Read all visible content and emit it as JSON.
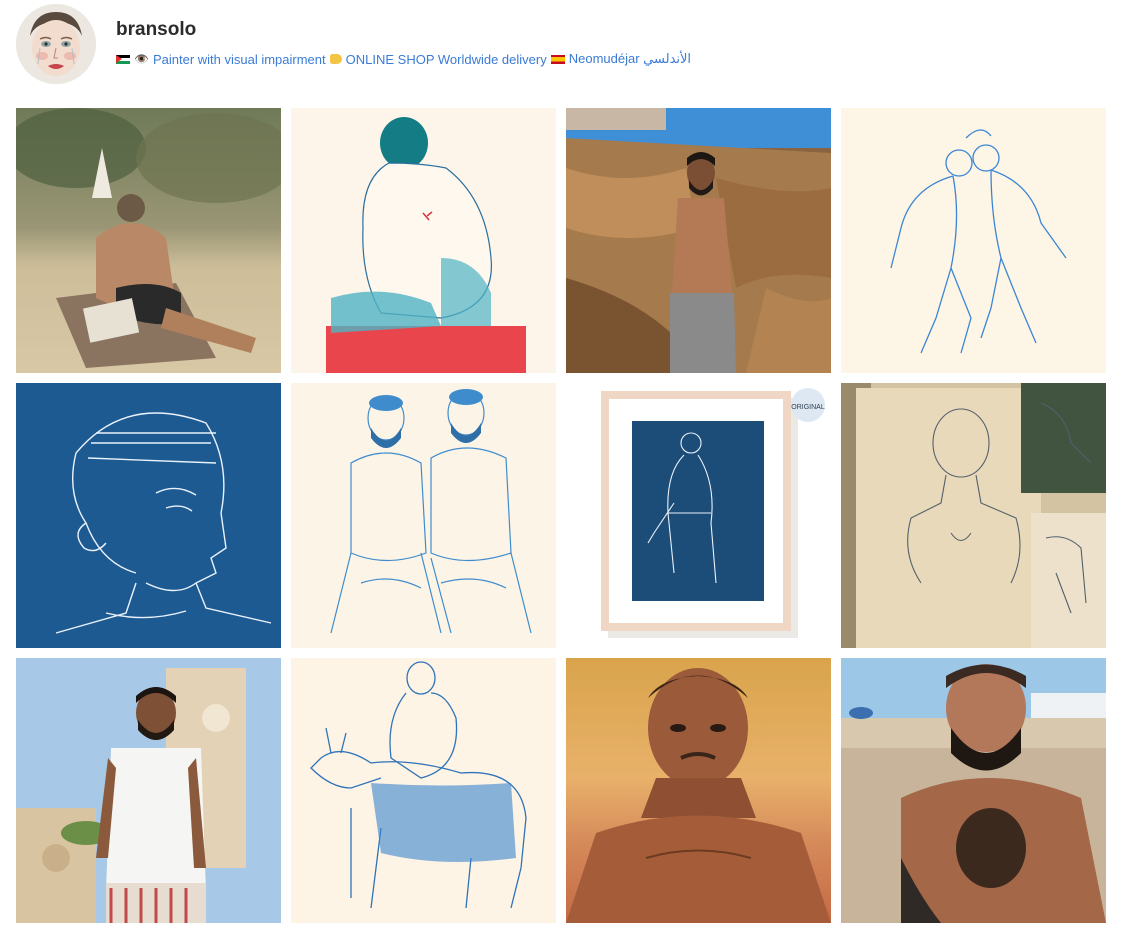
{
  "profile": {
    "username": "bransolo",
    "bio": {
      "flag1": "palestine-flag",
      "eye": "👁️",
      "text1": "Painter with visual impairment",
      "hand": "pointing-hand-icon",
      "text2": "ONLINE SHOP Worldwide delivery",
      "flag2": "spain-flag",
      "text3": "Neomudéjar الأندلسي"
    },
    "link_color": "#3a7bd5"
  },
  "grid": {
    "columns": 4,
    "rows": 3,
    "tiles": [
      {
        "name": "post-painting-beach-man-lying"
      },
      {
        "name": "post-drawing-man-back-red-block"
      },
      {
        "name": "post-photo-man-rocks"
      },
      {
        "name": "post-drawing-two-blue-figures"
      },
      {
        "name": "post-drawing-blue-portrait"
      },
      {
        "name": "post-drawing-two-bearded-men"
      },
      {
        "name": "post-framed-print-original",
        "badge": "ORIGINAL"
      },
      {
        "name": "post-sketches-on-wall"
      },
      {
        "name": "post-photo-man-tank-top"
      },
      {
        "name": "post-drawing-man-on-donkey"
      },
      {
        "name": "post-painting-man-portrait"
      },
      {
        "name": "post-photo-bearded-man-beach"
      }
    ]
  }
}
